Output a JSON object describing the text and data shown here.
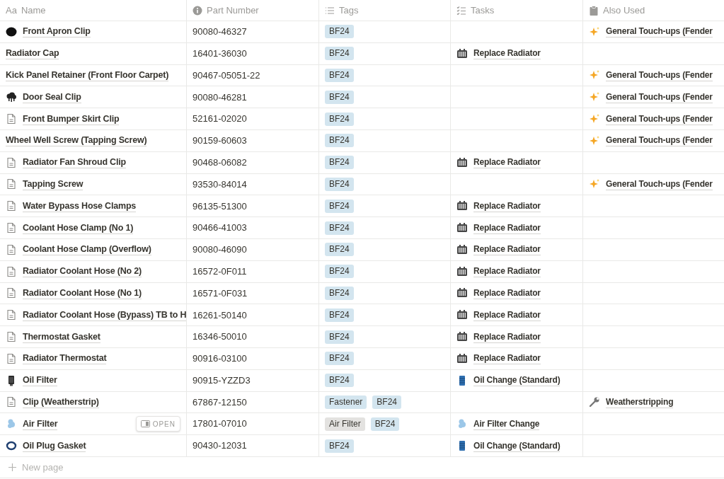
{
  "columns": [
    {
      "label": "Name",
      "kind": "title",
      "icon_text": "Aa"
    },
    {
      "label": "Part Number",
      "kind": "info"
    },
    {
      "label": "Tags",
      "kind": "list"
    },
    {
      "label": "Tasks",
      "kind": "checklist"
    },
    {
      "label": "Also Used",
      "kind": "clipboard"
    }
  ],
  "rows": [
    {
      "name": "Front Apron Clip",
      "kind": "blob",
      "part": "90080-46327",
      "tags": [
        {
          "label": "BF24",
          "color": "#d3e5ef"
        }
      ],
      "tasks": [],
      "also": [
        {
          "label": "General Touch-ups (Fender",
          "kind": "sparkle"
        }
      ]
    },
    {
      "name": "Radiator Cap",
      "kind": "none",
      "part": "16401-36030",
      "tags": [
        {
          "label": "BF24",
          "color": "#d3e5ef"
        }
      ],
      "tasks": [
        {
          "label": "Replace Radiator",
          "kind": "radiator"
        }
      ],
      "also": []
    },
    {
      "name": "Kick Panel Retainer (Front Floor Carpet)",
      "kind": "none",
      "part": "90467-05051-22",
      "tags": [
        {
          "label": "BF24",
          "color": "#d3e5ef"
        }
      ],
      "tasks": [],
      "also": [
        {
          "label": "General Touch-ups (Fender",
          "kind": "sparkle"
        }
      ]
    },
    {
      "name": "Door Seal Clip",
      "kind": "cloud",
      "part": "90080-46281",
      "tags": [
        {
          "label": "BF24",
          "color": "#d3e5ef"
        }
      ],
      "tasks": [],
      "also": [
        {
          "label": "General Touch-ups (Fender",
          "kind": "sparkle"
        }
      ]
    },
    {
      "name": "Front Bumper Skirt Clip",
      "kind": "page",
      "part": "52161-02020",
      "tags": [
        {
          "label": "BF24",
          "color": "#d3e5ef"
        }
      ],
      "tasks": [],
      "also": [
        {
          "label": "General Touch-ups (Fender",
          "kind": "sparkle"
        }
      ]
    },
    {
      "name": "Wheel Well Screw (Tapping Screw)",
      "kind": "none",
      "part": "90159-60603",
      "tags": [
        {
          "label": "BF24",
          "color": "#d3e5ef"
        }
      ],
      "tasks": [],
      "also": [
        {
          "label": "General Touch-ups (Fender",
          "kind": "sparkle"
        }
      ]
    },
    {
      "name": "Radiator Fan Shroud Clip",
      "kind": "page",
      "part": "90468-06082",
      "tags": [
        {
          "label": "BF24",
          "color": "#d3e5ef"
        }
      ],
      "tasks": [
        {
          "label": "Replace Radiator",
          "kind": "radiator"
        }
      ],
      "also": []
    },
    {
      "name": "Tapping Screw",
      "kind": "page",
      "part": "93530-84014",
      "tags": [
        {
          "label": "BF24",
          "color": "#d3e5ef"
        }
      ],
      "tasks": [],
      "also": [
        {
          "label": "General Touch-ups (Fender",
          "kind": "sparkle"
        }
      ]
    },
    {
      "name": "Water Bypass Hose Clamps",
      "kind": "page",
      "part": "96135-51300",
      "tags": [
        {
          "label": "BF24",
          "color": "#d3e5ef"
        }
      ],
      "tasks": [
        {
          "label": "Replace Radiator",
          "kind": "radiator"
        }
      ],
      "also": []
    },
    {
      "name": "Coolant Hose Clamp (No 1)",
      "kind": "page",
      "part": "90466-41003",
      "tags": [
        {
          "label": "BF24",
          "color": "#d3e5ef"
        }
      ],
      "tasks": [
        {
          "label": "Replace Radiator",
          "kind": "radiator"
        }
      ],
      "also": []
    },
    {
      "name": "Coolant Hose Clamp (Overflow)",
      "kind": "page",
      "part": "90080-46090",
      "tags": [
        {
          "label": "BF24",
          "color": "#d3e5ef"
        }
      ],
      "tasks": [
        {
          "label": "Replace Radiator",
          "kind": "radiator"
        }
      ],
      "also": []
    },
    {
      "name": "Radiator Coolant Hose (No 2)",
      "kind": "page",
      "part": "16572-0F011",
      "tags": [
        {
          "label": "BF24",
          "color": "#d3e5ef"
        }
      ],
      "tasks": [
        {
          "label": "Replace Radiator",
          "kind": "radiator"
        }
      ],
      "also": []
    },
    {
      "name": "Radiator Coolant Hose (No 1)",
      "kind": "page",
      "part": "16571-0F031",
      "tags": [
        {
          "label": "BF24",
          "color": "#d3e5ef"
        }
      ],
      "tasks": [
        {
          "label": "Replace Radiator",
          "kind": "radiator"
        }
      ],
      "also": []
    },
    {
      "name": "Radiator Coolant Hose (Bypass) TB to H",
      "kind": "page",
      "part": "16261-50140",
      "tags": [
        {
          "label": "BF24",
          "color": "#d3e5ef"
        }
      ],
      "tasks": [
        {
          "label": "Replace Radiator",
          "kind": "radiator"
        }
      ],
      "also": []
    },
    {
      "name": "Thermostat Gasket",
      "kind": "page",
      "part": "16346-50010",
      "tags": [
        {
          "label": "BF24",
          "color": "#d3e5ef"
        }
      ],
      "tasks": [
        {
          "label": "Replace Radiator",
          "kind": "radiator"
        }
      ],
      "also": []
    },
    {
      "name": "Radiator Thermostat",
      "kind": "page",
      "part": "90916-03100",
      "tags": [
        {
          "label": "BF24",
          "color": "#d3e5ef"
        }
      ],
      "tasks": [
        {
          "label": "Replace Radiator",
          "kind": "radiator"
        }
      ],
      "also": []
    },
    {
      "name": "Oil Filter",
      "kind": "cartridge",
      "part": "90915-YZZD3",
      "tags": [
        {
          "label": "BF24",
          "color": "#d3e5ef"
        }
      ],
      "tasks": [
        {
          "label": "Oil Change (Standard)",
          "kind": "barrel"
        }
      ],
      "also": []
    },
    {
      "name": "Clip (Weatherstrip)",
      "kind": "page",
      "part": "67867-12150",
      "tags": [
        {
          "label": "Fastener",
          "color": "#d3e5ef"
        },
        {
          "label": "BF24",
          "color": "#d3e5ef"
        }
      ],
      "tasks": [],
      "also": [
        {
          "label": "Weatherstripping",
          "kind": "wrench"
        }
      ]
    },
    {
      "name": "Air Filter",
      "kind": "air",
      "open_button": "OPEN",
      "part": "17801-07010",
      "tags": [
        {
          "label": "Air Filter",
          "color": "#e3e2e0"
        },
        {
          "label": "BF24",
          "color": "#d3e5ef"
        }
      ],
      "tasks": [
        {
          "label": "Air Filter Change",
          "kind": "air"
        }
      ],
      "also": []
    },
    {
      "name": "Oil Plug Gasket",
      "kind": "ring",
      "part": "90430-12031",
      "tags": [
        {
          "label": "BF24",
          "color": "#d3e5ef"
        }
      ],
      "tasks": [
        {
          "label": "Oil Change (Standard)",
          "kind": "barrel"
        }
      ],
      "also": []
    }
  ],
  "new_page": {
    "label": "New page"
  }
}
